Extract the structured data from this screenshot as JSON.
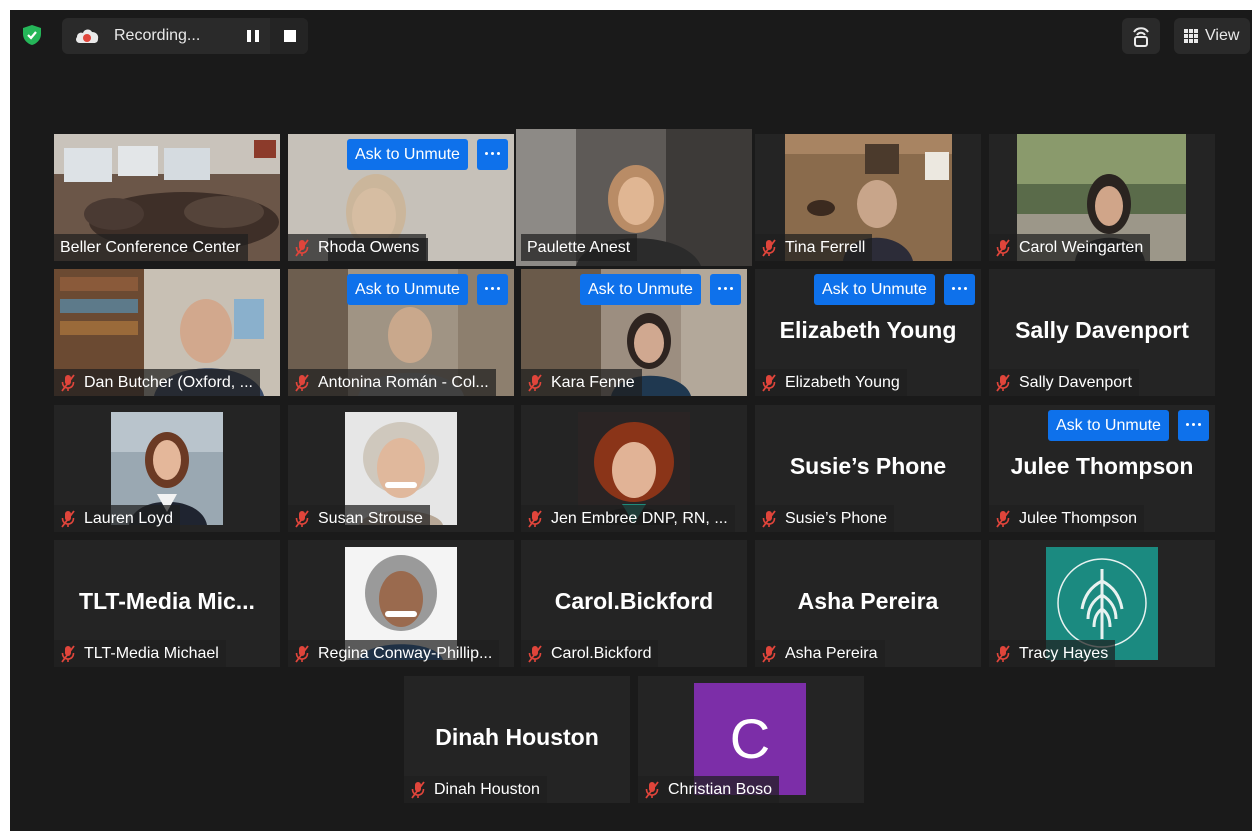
{
  "topbar": {
    "recording_label": "Recording...",
    "view_label": "View"
  },
  "ask_to_unmute_label": "Ask to Unmute",
  "tiles": {
    "beller": {
      "name": "Beller Conference Center"
    },
    "rhoda": {
      "name": "Rhoda Owens"
    },
    "paulette": {
      "name": "Paulette Anest"
    },
    "tina": {
      "name": "Tina Ferrell"
    },
    "carolw": {
      "name": "Carol Weingarten"
    },
    "dan": {
      "name": "Dan Butcher (Oxford, ..."
    },
    "antonina": {
      "name": "Antonina Román - Col..."
    },
    "kara": {
      "name": "Kara Fenne"
    },
    "elizabeth": {
      "name": "Elizabeth Young",
      "display": "Elizabeth Young"
    },
    "sally": {
      "name": "Sally Davenport",
      "display": "Sally Davenport"
    },
    "lauren": {
      "name": "Lauren Loyd"
    },
    "susan": {
      "name": "Susan Strouse"
    },
    "jen": {
      "name": "Jen Embree DNP, RN, ..."
    },
    "susie": {
      "name": "Susie’s Phone",
      "display": "Susie’s Phone"
    },
    "julee": {
      "name": "Julee Thompson",
      "display": "Julee Thompson"
    },
    "tlt": {
      "name": "TLT-Media Michael",
      "display": "TLT-Media  Mic..."
    },
    "regina": {
      "name": "Regina Conway-Phillip..."
    },
    "carolb": {
      "name": "Carol.Bickford",
      "display": "Carol.Bickford"
    },
    "asha": {
      "name": "Asha Pereira",
      "display": "Asha Pereira"
    },
    "tracy": {
      "name": "Tracy Hayes"
    },
    "dinah": {
      "name": "Dinah Houston",
      "display": "Dinah Houston"
    },
    "christian": {
      "name": "Christian Boso",
      "avatar_letter": "C"
    }
  },
  "colors": {
    "background": "#1a1a1a",
    "tile": "#242424",
    "accent_blue": "#0e71eb",
    "active_speaker": "#c9e26f",
    "muted_red": "#e0453b",
    "avatar_purple": "#7c2ea8",
    "logo_teal": "#1b8a80"
  }
}
